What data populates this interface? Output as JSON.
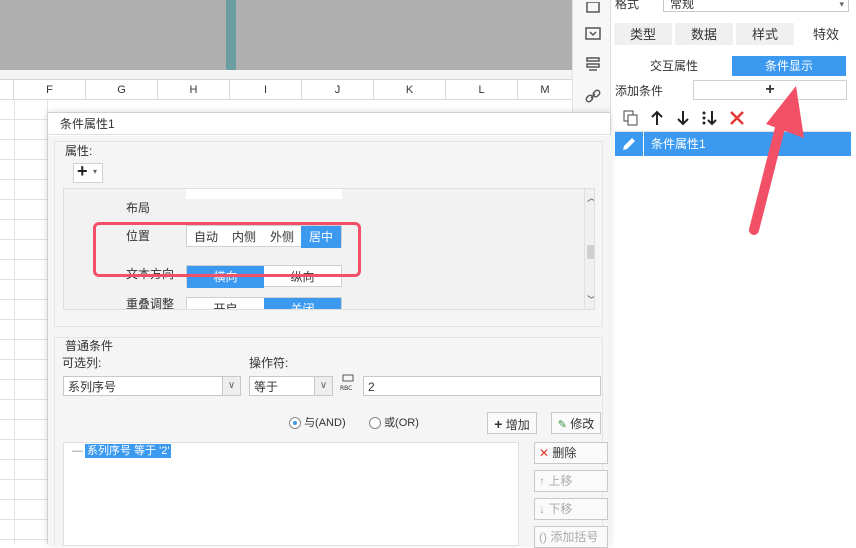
{
  "sheet": {
    "columns": [
      "F",
      "G",
      "H",
      "I",
      "J",
      "K",
      "L",
      "M"
    ]
  },
  "right_panel": {
    "format_label": "格式",
    "format_value": "常规",
    "tabs": [
      "类型",
      "数据",
      "样式",
      "特效"
    ],
    "sub_tabs": [
      "交互属性",
      "条件显示"
    ],
    "add_condition_label": "添加条件",
    "add_symbol": "+",
    "list_item": "条件属性1"
  },
  "dialog": {
    "title": "条件属性1",
    "property_section": "属性:",
    "add_symbol": "+",
    "rows": [
      {
        "label": "布局"
      },
      {
        "label": "位置",
        "options": [
          "自动",
          "内侧",
          "外侧",
          "居中"
        ],
        "selected": 3
      },
      {
        "label": "文本方向",
        "options": [
          "横向",
          "纵向"
        ],
        "selected": 0
      },
      {
        "label": "重叠调整",
        "options": [
          "开启",
          "关闭"
        ],
        "selected": 1
      }
    ],
    "condition_section": "普通条件",
    "optional_column_label": "可选列:",
    "optional_column_value": "系列序号",
    "operator_label": "操作符:",
    "operator_value": "等于",
    "value_input": "2",
    "radio_and": "与(AND)",
    "radio_or": "或(OR)",
    "add_button": "增加",
    "modify_button": "修改",
    "condition_item": "系列序号 等于 '2'",
    "delete_button": "删除",
    "move_up_button": "上移",
    "move_down_button": "下移",
    "add_bracket_button": "添加括号"
  },
  "colors": {
    "accent": "#3b99f0",
    "highlight": "#f25066"
  }
}
